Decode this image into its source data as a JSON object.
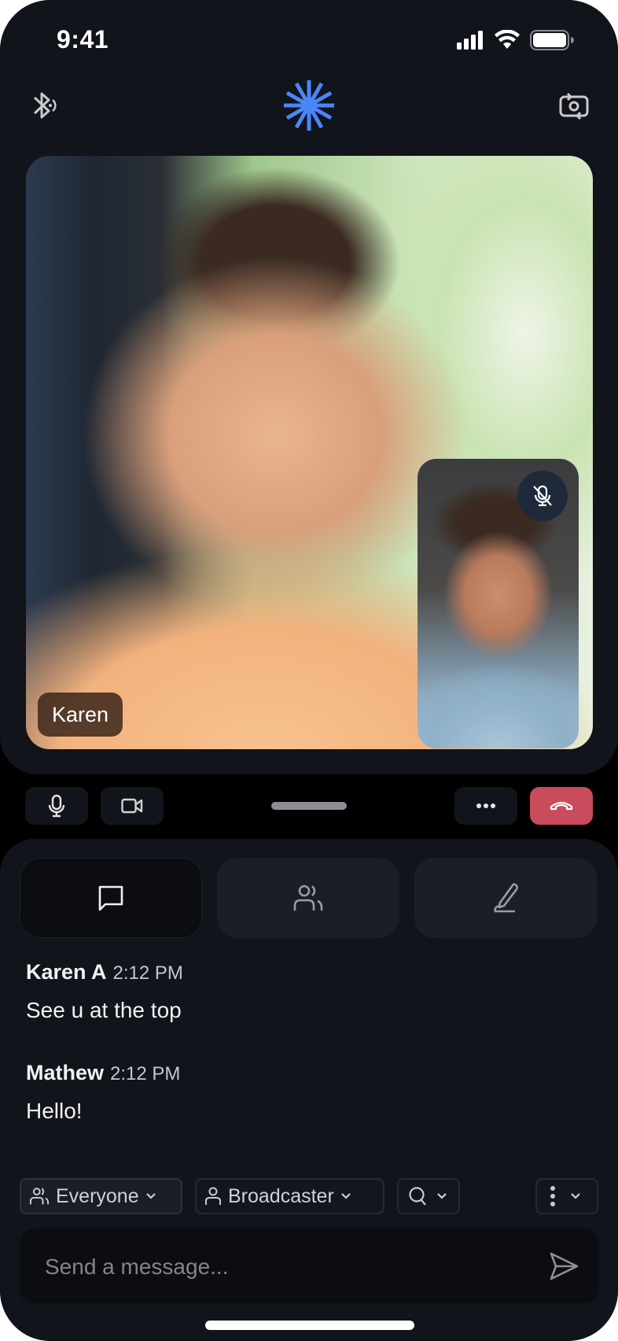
{
  "status_bar": {
    "time": "9:41"
  },
  "header": {
    "left_icon": "bluetooth-audio-icon",
    "logo_icon": "starburst-logo-icon",
    "logo_color": "#4a86f7",
    "right_icon": "switch-camera-icon"
  },
  "video": {
    "main_participant_name": "Karen",
    "pip_participant_muted": true,
    "pip_mute_icon": "mic-off-icon"
  },
  "controls": {
    "mic_icon": "microphone-icon",
    "camera_icon": "video-camera-icon",
    "more_icon": "more-horizontal-icon",
    "end_call_icon": "hang-up-icon",
    "end_call_color": "#c94b5c"
  },
  "tabs": [
    {
      "name": "chat",
      "icon": "chat-bubble-icon",
      "active": true
    },
    {
      "name": "participants",
      "icon": "users-icon",
      "active": false
    },
    {
      "name": "whiteboard",
      "icon": "pen-icon",
      "active": false
    }
  ],
  "messages": [
    {
      "sender": "Karen A",
      "time": "2:12 PM",
      "text": "See u at the top"
    },
    {
      "sender": "Mathew",
      "time": "2:12 PM",
      "text": "Hello!"
    }
  ],
  "filters": {
    "audience": {
      "label": "Everyone",
      "icon": "users-icon"
    },
    "role": {
      "label": "Broadcaster",
      "icon": "user-icon"
    },
    "search": {
      "icon": "search-icon"
    },
    "more": {
      "icon": "more-vertical-icon"
    }
  },
  "composer": {
    "placeholder": "Send a message...",
    "value": "",
    "send_icon": "send-icon"
  }
}
